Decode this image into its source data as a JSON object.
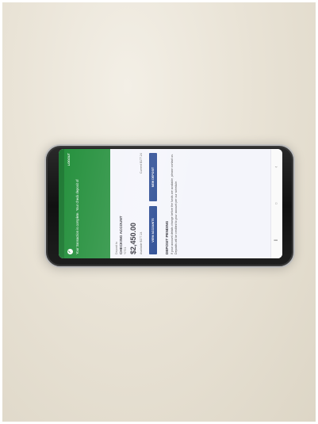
{
  "status_bar": {
    "time": "",
    "battery": ""
  },
  "header": {
    "logout_label": "LOGOUT",
    "banner_text": "Your transaction is complete. Your check deposit of"
  },
  "account": {
    "label": "Deposit to",
    "name": "CHECKING ACCOUNT",
    "number": "*0701",
    "amount": "$2,450.00",
    "available_label": "Available",
    "available_value": "$177.24",
    "current_label": "Current",
    "current_value": "$177.24"
  },
  "buttons": {
    "view_accounts": "VIEW ACCOUNTS",
    "new_deposit": "NEW DEPOSIT"
  },
  "pending": {
    "title": "DEPOSIT PENDING",
    "text": "If your account details change before the funds are available, please contact us. Deposits will be credited to your account per our schedule."
  },
  "nav": {
    "icons": [
      "recent-apps-icon",
      "home-icon",
      "back-icon"
    ]
  },
  "colors": {
    "header_green": "#25903d",
    "button_blue": "#1c3f8c",
    "screen_bg": "#f4f5fb"
  }
}
